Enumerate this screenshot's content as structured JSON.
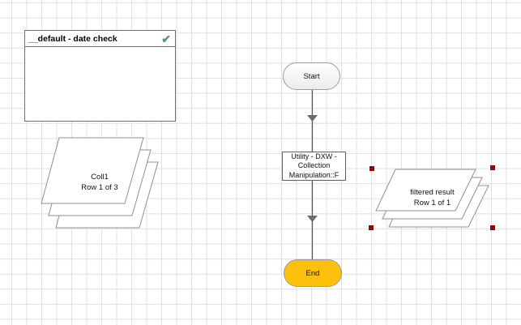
{
  "panel": {
    "title": "__default - date check",
    "check_icon": "✔",
    "check_color": "#4d9e6d"
  },
  "flow": {
    "start_label": "Start",
    "action": {
      "line1": "Utility - DXW -",
      "line2": "Collection",
      "line3": "Manipulation::F"
    },
    "end_label": "End",
    "end_fill": "#fcc00d",
    "link_color": "#5a5a5a",
    "arrow_color": "#6b6b6b"
  },
  "collections": {
    "left": {
      "name": "Coll1",
      "row_status": "Row 1 of 3"
    },
    "right": {
      "name": "filtered result",
      "row_status": "Row 1 of 1",
      "selected": true
    }
  },
  "selection": {
    "handle_color": "#8e0a0a"
  }
}
